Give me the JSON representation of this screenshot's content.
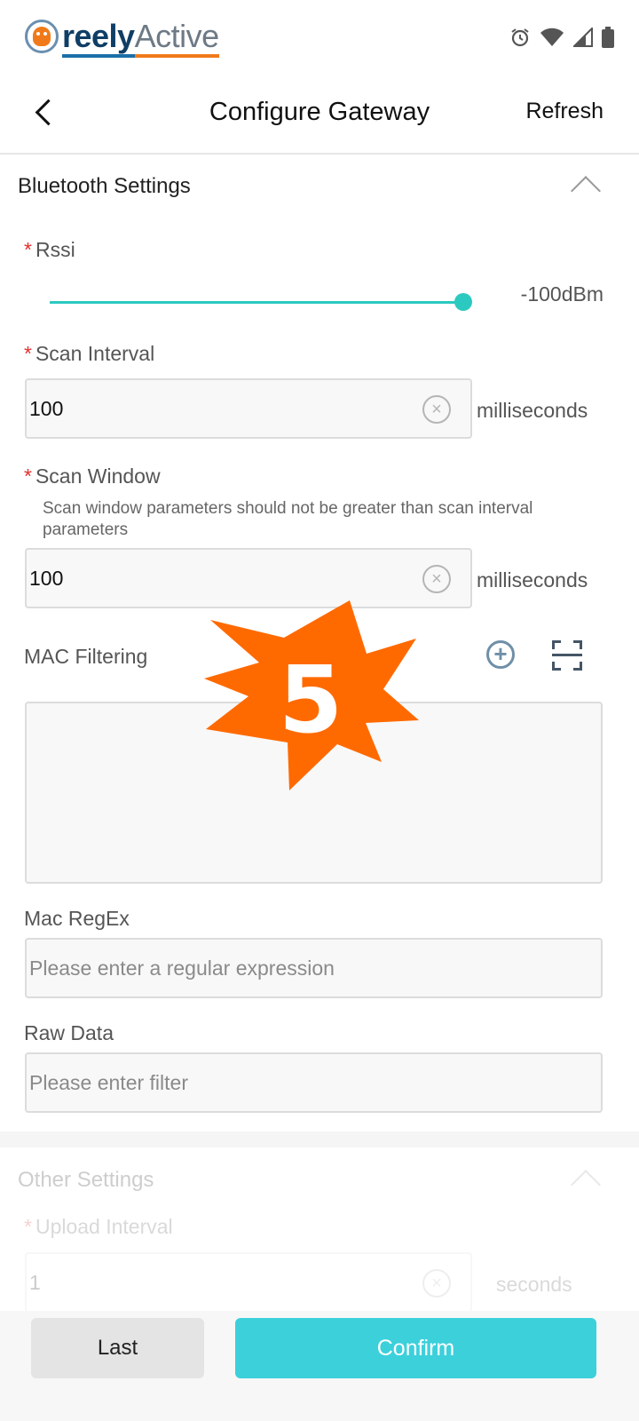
{
  "status_bar": {
    "logo_text_bold": "reely",
    "logo_text_light": "Active",
    "icons": [
      "alarm-icon",
      "wifi-icon",
      "signal-icon",
      "battery-icon"
    ]
  },
  "header": {
    "title": "Configure Gateway",
    "refresh_label": "Refresh"
  },
  "bluetooth": {
    "section_title": "Bluetooth Settings",
    "rssi": {
      "label": "Rssi",
      "value_text": "-100dBm",
      "slider_fraction": 1.0
    },
    "scan_interval": {
      "label": "Scan Interval",
      "value": "100",
      "unit": "milliseconds"
    },
    "scan_window": {
      "label": "Scan Window",
      "hint": "Scan window parameters should not be greater than scan interval parameters",
      "value": "100",
      "unit": "milliseconds"
    },
    "mac_filtering": {
      "label": "MAC Filtering"
    },
    "mac_regex": {
      "label": "Mac RegEx",
      "placeholder": "Please enter a regular expression"
    },
    "raw_data": {
      "label": "Raw Data",
      "placeholder": "Please enter filter"
    }
  },
  "other": {
    "section_title": "Other Settings",
    "upload_interval": {
      "label": "Upload Interval",
      "value": "1",
      "unit": "seconds"
    }
  },
  "footer": {
    "last_label": "Last",
    "confirm_label": "Confirm"
  },
  "overlay": {
    "badge_number": "5"
  },
  "colors": {
    "accent": "#3cd0db",
    "slider": "#2cc9c0",
    "required": "#e23030",
    "badge": "#ff6a00"
  }
}
